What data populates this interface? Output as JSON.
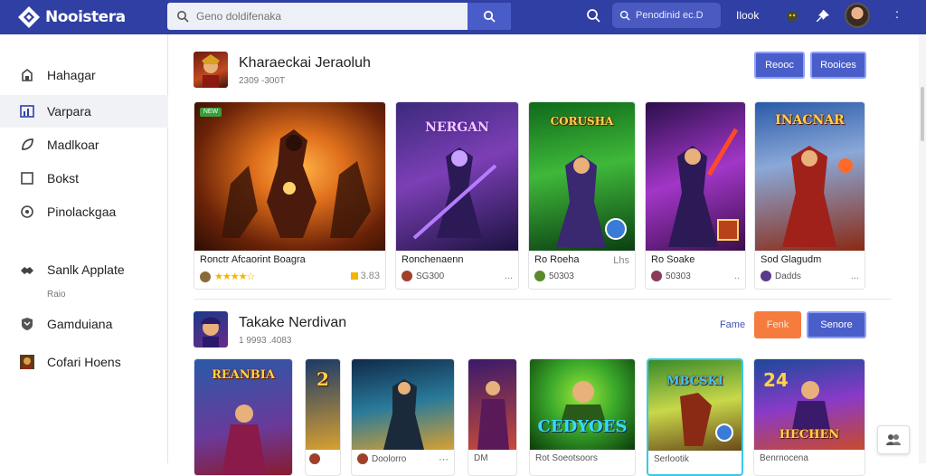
{
  "topbar": {
    "app_name": "Nooistera",
    "search_placeholder": "Geno doldifenaka",
    "pill_label": "Penodinid ec.D",
    "link_text": "Ilook"
  },
  "sidebar": {
    "items": [
      {
        "label": "Hahagar",
        "icon": "tag-icon"
      },
      {
        "label": "Varpara",
        "icon": "chart-icon"
      },
      {
        "label": "Madlkoar",
        "icon": "leaf-icon"
      },
      {
        "label": "Bokst",
        "icon": "square-icon"
      },
      {
        "label": "Pinolackgaa",
        "icon": "pin-icon"
      },
      {
        "label": "Sanlk Applate",
        "icon": "handshake-icon"
      },
      {
        "label": "Gamduiana",
        "icon": "shield-icon"
      },
      {
        "label": "Cofari Hoens",
        "icon": "game-thumb-icon"
      }
    ],
    "sub_label": "Raio"
  },
  "sections": [
    {
      "title": "Kharaeckai Jeraoluh",
      "subtitle": "2309 -300T",
      "buttons": [
        "Reooc",
        "Rooices"
      ],
      "cards": [
        {
          "title": "Ronctr Afcaorint Boagra",
          "meta": "",
          "rating": "★★★★☆",
          "extra": "3.83",
          "new_badge": "NEW"
        },
        {
          "title": "Ronchenaenn",
          "meta": "SG300",
          "extra": "...",
          "art_text": "NERGAN"
        },
        {
          "title": "Ro Roeha",
          "meta": "50303",
          "extra": "Lhs",
          "art_text": "CORUSHA"
        },
        {
          "title": "Ro Soake",
          "meta": "50303",
          "extra": "..",
          "art_text": ""
        },
        {
          "title": "Sod Glagudm",
          "meta": "Dadds",
          "extra": "...",
          "art_text": "INACNAR"
        }
      ]
    },
    {
      "title": "Takake Nerdivan",
      "subtitle": "1 9993 .4083",
      "buttons": [
        "Fame",
        "Fenk",
        "Senore"
      ],
      "cards": [
        {
          "title": "",
          "art_text": "REANBIA"
        },
        {
          "title": "",
          "art_text": "2"
        },
        {
          "title": "Doolorro",
          "art_text": ""
        },
        {
          "title": "DM",
          "art_text": ""
        },
        {
          "title": "Rot Soeotsoors",
          "art_text": "CEDYOES"
        },
        {
          "title": "Serlootik",
          "art_text": "MBCSKI"
        },
        {
          "title": "Benrnocena",
          "art_text": "HECHEN"
        }
      ]
    }
  ],
  "colors": {
    "topbar": "#2f3fa3",
    "accent": "#4a5ec9",
    "orange": "#f57b3e"
  }
}
